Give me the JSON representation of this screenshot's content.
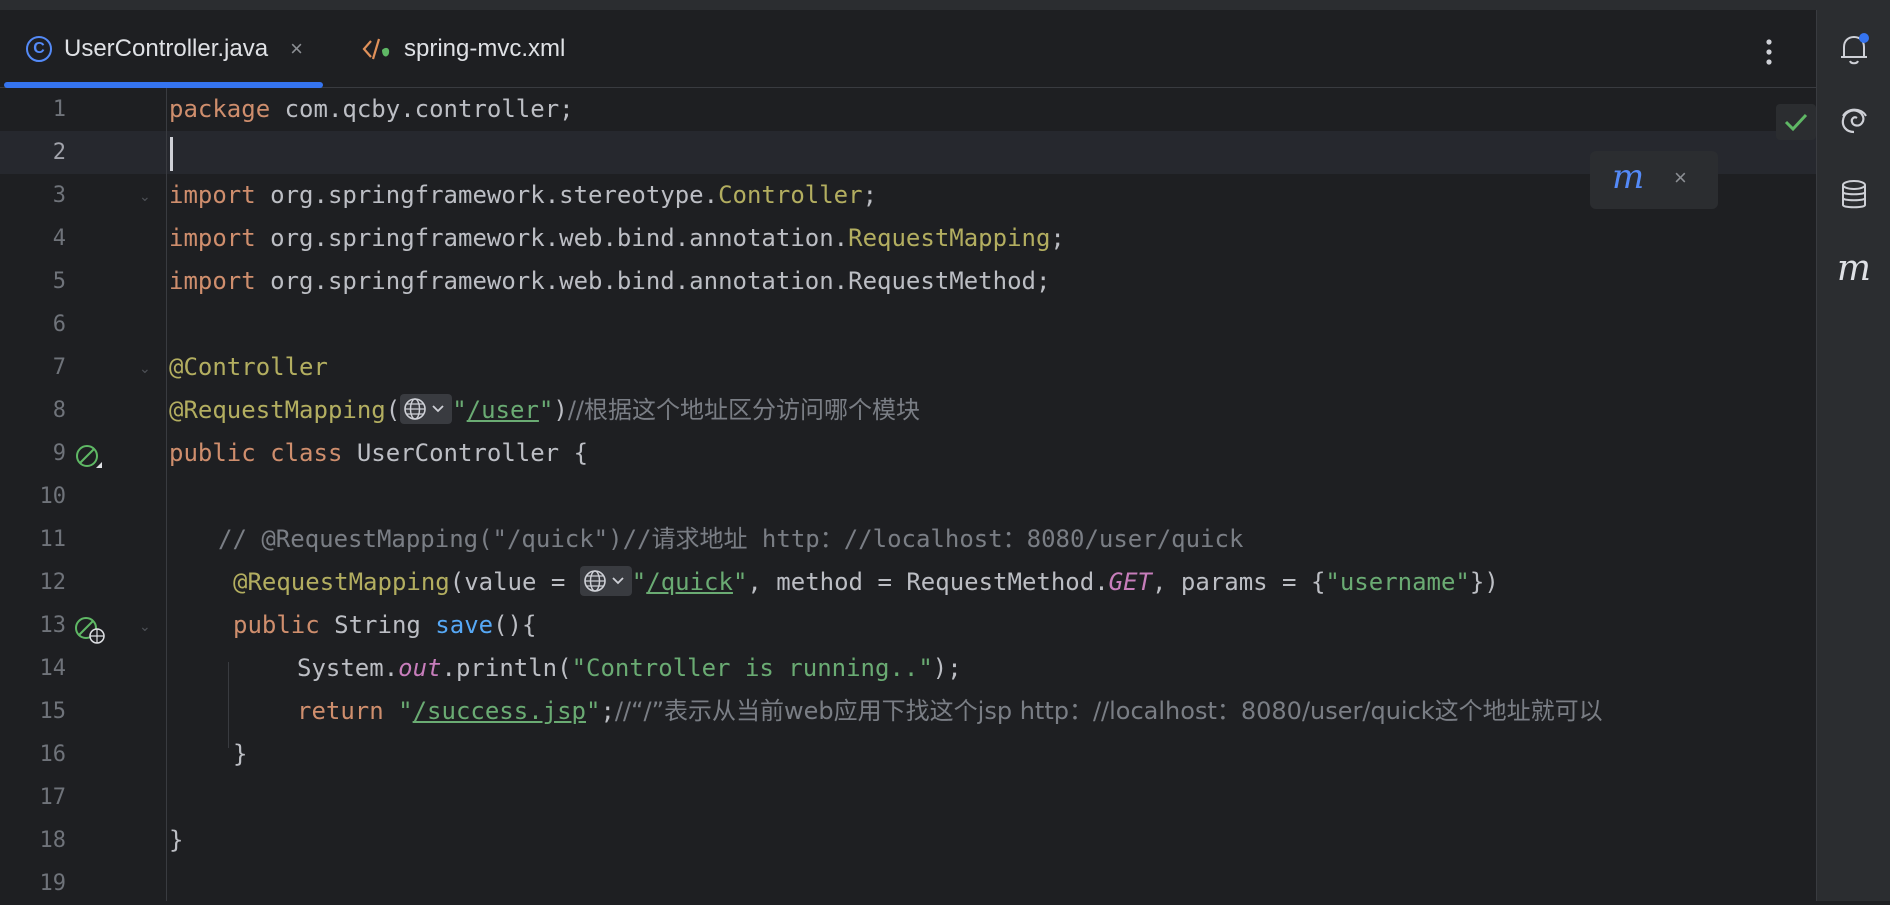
{
  "tabs": [
    {
      "label": "UserController.java",
      "icon": "java-class-icon",
      "active": true,
      "close": "×"
    },
    {
      "label": "spring-mvc.xml",
      "icon": "xml-file-icon",
      "active": false
    }
  ],
  "line_numbers": [
    "1",
    "2",
    "3",
    "4",
    "5",
    "6",
    "7",
    "8",
    "9",
    "10",
    "11",
    "12",
    "13",
    "14",
    "15",
    "16",
    "17",
    "18",
    "19"
  ],
  "code": {
    "l1_kw": "package",
    "l1_rest": " com.qcby.controller;",
    "l3_kw": "import",
    "l3_pkg": " org.springframework.stereotype.",
    "l3_cls": "Controller",
    "l3_end": ";",
    "l4_kw": "import",
    "l4_pkg": " org.springframework.web.bind.annotation.",
    "l4_cls": "RequestMapping",
    "l4_end": ";",
    "l5_kw": "import",
    "l5_rest": " org.springframework.web.bind.annotation.RequestMethod;",
    "l7_ann": "@Controller",
    "l8_ann": "@RequestMapping",
    "l8_open": "(",
    "l8_q1": "\"",
    "l8_url": "/user",
    "l8_q2": "\"",
    "l8_close": ")",
    "l8_cmt": "//根据这个地址区分访问哪个模块",
    "l9_kw": "public class",
    "l9_rest": " UserController {",
    "l11_cmt": "// @RequestMapping(\"/quick\")//请求地址 http：//localhost：8080/user/quick",
    "l12_ann": "@RequestMapping",
    "l12_a": "(value = ",
    "l12_q1": "\"",
    "l12_url": "/quick",
    "l12_q2": "\"",
    "l12_b": ", method = RequestMethod.",
    "l12_get": "GET",
    "l12_c": ", params = {",
    "l12_str": "\"username\"",
    "l12_d": "})",
    "l13_kw": "public",
    "l13_a": " String ",
    "l13_fn": "save",
    "l13_b": "(){",
    "l14_a": "System.",
    "l14_out": "out",
    "l14_b": ".println(",
    "l14_str": "\"Controller is running..\"",
    "l14_c": ");",
    "l15_kw": "return",
    "l15_sp": " ",
    "l15_q1": "\"",
    "l15_url": "/success.jsp",
    "l15_q2": "\"",
    "l15_semi": ";",
    "l15_cmt": "//“/”表示从当前web应用下找这个jsp http：//localhost：8080/user/quick这个地址就可以",
    "l16": "}",
    "l18": "}"
  },
  "popup": {
    "icon": "maven-reload-icon",
    "close": "×"
  },
  "right_toolbar": [
    "notifications-icon",
    "ai-assistant-icon",
    "database-icon",
    "maven-icon"
  ],
  "colors": {
    "accent": "#3574f0",
    "keyword": "#cf8e6d",
    "annotation": "#b3ae60",
    "string": "#6aab73",
    "comment": "#7a7e85",
    "function": "#56a8f5",
    "static": "#c77dbb"
  }
}
